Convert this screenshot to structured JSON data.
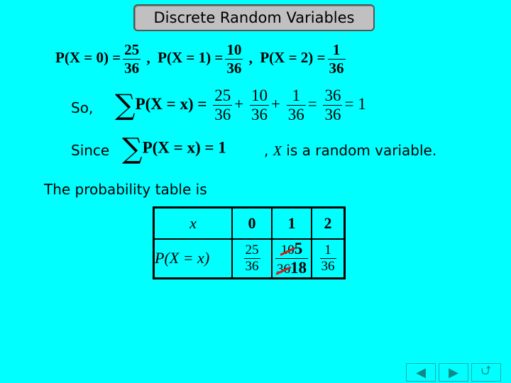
{
  "header": {
    "title": "Discrete Random Variables"
  },
  "line1": [
    {
      "lhs": "P(X = 0) =",
      "num": "25",
      "den": "36"
    },
    {
      "lhs": "P(X = 1) =",
      "num": "10",
      "den": "36"
    },
    {
      "lhs": "P(X = 2) =",
      "num": "1",
      "den": "36"
    }
  ],
  "line2": {
    "lead": "So,",
    "sum_expr": "P(X = x) =",
    "terms": [
      {
        "num": "25",
        "den": "36"
      },
      {
        "num": "10",
        "den": "36"
      },
      {
        "num": "1",
        "den": "36"
      }
    ],
    "total": {
      "num": "36",
      "den": "36"
    },
    "result": "= 1"
  },
  "line3": {
    "lead": "Since",
    "sum_expr": "P(X = x) = 1",
    "tail_var": "X",
    "tail": "is a random variable."
  },
  "table_intro": "The probability table is",
  "table": {
    "row_x_label": "x",
    "row_p_label": "P(X = x)",
    "x_values": [
      "0",
      "1",
      "2"
    ],
    "p_values": [
      {
        "num": "25",
        "den": "36"
      },
      {
        "num_struck": "10",
        "num_new": "5",
        "den_struck": "36",
        "den_new": "18"
      },
      {
        "num": "1",
        "den": "36"
      }
    ]
  },
  "nav": {
    "prev_icon": "◀",
    "next_icon": "▶",
    "return_icon": "⮍"
  }
}
